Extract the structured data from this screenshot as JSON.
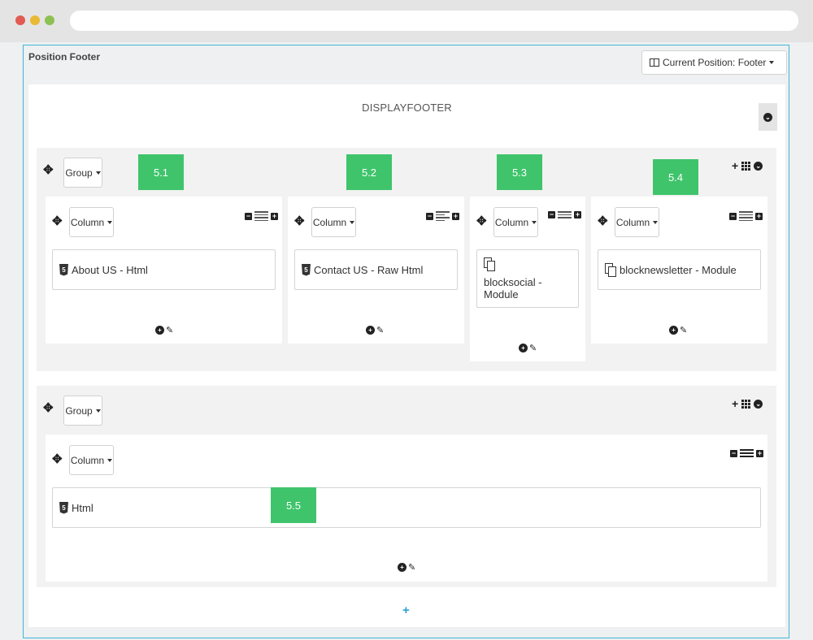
{
  "window": {
    "title": ""
  },
  "header": {
    "title": "Position Footer",
    "position_button": "Current Position: Footer"
  },
  "hook": {
    "name": "DISPLAYFOOTER"
  },
  "icons": {
    "move": "✥",
    "plus_circle": "+",
    "pencil": "✎",
    "chevron_circle": "⌄",
    "minus_square": "−",
    "plus_square": "+",
    "add_group": "+"
  },
  "groups": [
    {
      "label": "Group",
      "columns": [
        {
          "label": "Column",
          "module_type": "html",
          "module": "About US - Html",
          "badge": "5.1"
        },
        {
          "label": "Column",
          "module_type": "html",
          "module": "Contact US - Raw Html",
          "badge": "5.2"
        },
        {
          "label": "Column",
          "module_type": "module",
          "module": "blocksocial - Module",
          "badge": "5.3"
        },
        {
          "label": "Column",
          "module_type": "module",
          "module": "blocknewsletter - Module",
          "badge": "5.4"
        }
      ]
    },
    {
      "label": "Group",
      "columns": [
        {
          "label": "Column",
          "module_type": "html",
          "module": "Html",
          "badge": "5.5"
        }
      ]
    }
  ],
  "colors": {
    "accent": "#3fb6d8",
    "badge": "#3fc46b",
    "add": "#2a9fd6"
  }
}
